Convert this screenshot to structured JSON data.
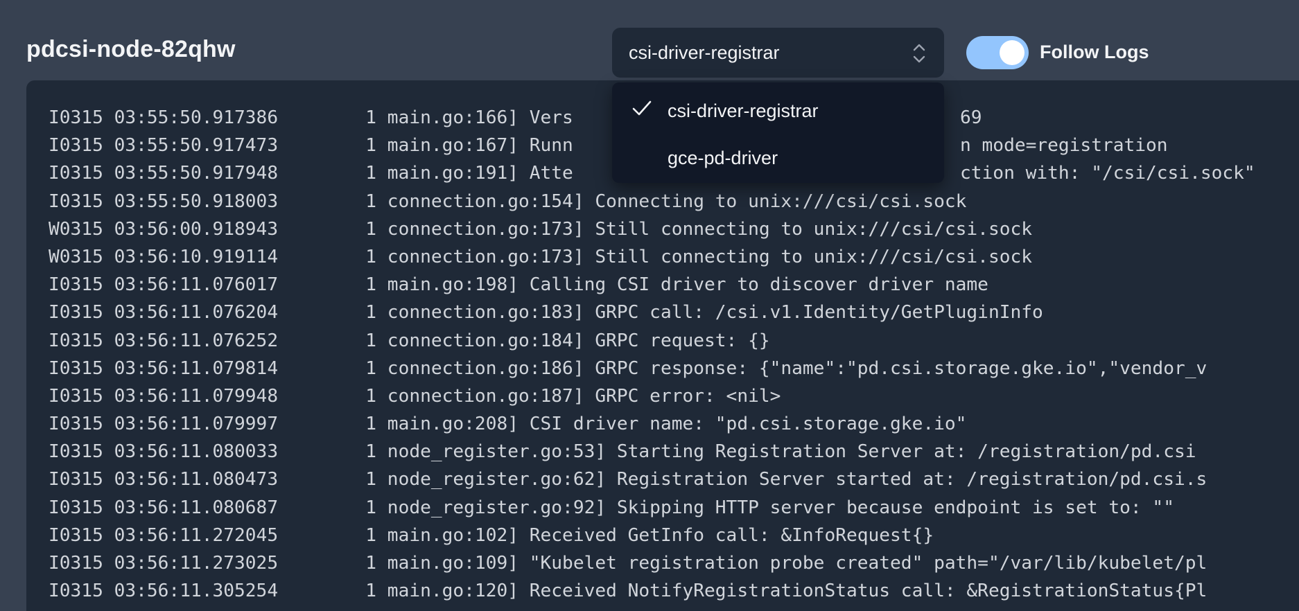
{
  "header": {
    "pod_name": "pdcsi-node-82qhw",
    "container_select": {
      "selected": "csi-driver-registrar",
      "icon": "chevron-up-down-icon"
    },
    "follow_logs": {
      "label": "Follow Logs",
      "enabled": true
    }
  },
  "dropdown": {
    "items": [
      {
        "label": "csi-driver-registrar",
        "selected": true,
        "icon": "checkmark-icon"
      },
      {
        "label": "gce-pd-driver",
        "selected": false
      }
    ]
  },
  "logs": {
    "lines": [
      {
        "ts": "I0315 03:55:50.917386",
        "n": "1",
        "msg": "main.go:166] Vers"
      },
      {
        "ts": "I0315 03:55:50.917473",
        "n": "1",
        "msg": "main.go:167] Runn"
      },
      {
        "ts": "I0315 03:55:50.917948",
        "n": "1",
        "msg": "main.go:191] Atte"
      },
      {
        "ts": "I0315 03:55:50.918003",
        "n": "1",
        "msg": "connection.go:154] Connecting to unix:///csi/csi.sock"
      },
      {
        "ts": "W0315 03:56:00.918943",
        "n": "1",
        "msg": "connection.go:173] Still connecting to unix:///csi/csi.sock"
      },
      {
        "ts": "W0315 03:56:10.919114",
        "n": "1",
        "msg": "connection.go:173] Still connecting to unix:///csi/csi.sock"
      },
      {
        "ts": "I0315 03:56:11.076017",
        "n": "1",
        "msg": "main.go:198] Calling CSI driver to discover driver name"
      },
      {
        "ts": "I0315 03:56:11.076204",
        "n": "1",
        "msg": "connection.go:183] GRPC call: /csi.v1.Identity/GetPluginInfo"
      },
      {
        "ts": "I0315 03:56:11.076252",
        "n": "1",
        "msg": "connection.go:184] GRPC request: {}"
      },
      {
        "ts": "I0315 03:56:11.079814",
        "n": "1",
        "msg": "connection.go:186] GRPC response: {\"name\":\"pd.csi.storage.gke.io\",\"vendor_v"
      },
      {
        "ts": "I0315 03:56:11.079948",
        "n": "1",
        "msg": "connection.go:187] GRPC error: <nil>"
      },
      {
        "ts": "I0315 03:56:11.079997",
        "n": "1",
        "msg": "main.go:208] CSI driver name: \"pd.csi.storage.gke.io\""
      },
      {
        "ts": "I0315 03:56:11.080033",
        "n": "1",
        "msg": "node_register.go:53] Starting Registration Server at: /registration/pd.csi"
      },
      {
        "ts": "I0315 03:56:11.080473",
        "n": "1",
        "msg": "node_register.go:62] Registration Server started at: /registration/pd.csi.s"
      },
      {
        "ts": "I0315 03:56:11.080687",
        "n": "1",
        "msg": "node_register.go:92] Skipping HTTP server because endpoint is set to: \"\""
      },
      {
        "ts": "I0315 03:56:11.272045",
        "n": "1",
        "msg": "main.go:102] Received GetInfo call: &InfoRequest{}"
      },
      {
        "ts": "I0315 03:56:11.273025",
        "n": "1",
        "msg": "main.go:109] \"Kubelet registration probe created\" path=\"/var/lib/kubelet/pl"
      },
      {
        "ts": "I0315 03:56:11.305254",
        "n": "1",
        "msg": "main.go:120] Received NotifyRegistrationStatus call: &RegistrationStatus{Pl"
      }
    ],
    "partial_visible_fragments": {
      "line1_tail": "69",
      "line2_tail": "n mode=registration",
      "line3_tail": "ction with: \"/csi/csi.sock\""
    }
  }
}
